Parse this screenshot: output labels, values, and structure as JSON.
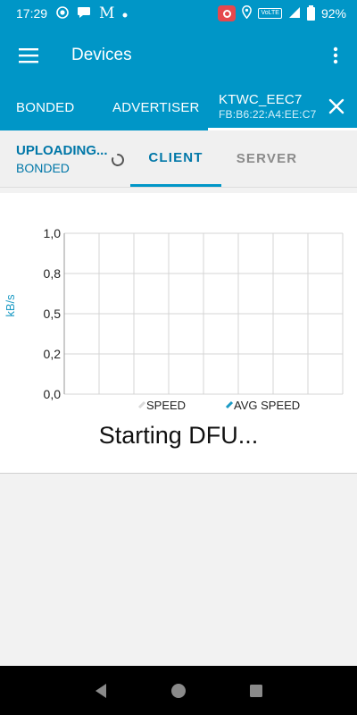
{
  "status_bar": {
    "time": "17:29",
    "battery": "92%",
    "volte": "VoLTE",
    "icons": [
      "screen-record-icon",
      "chat-icon",
      "gmail-icon",
      "dot-icon",
      "recording-badge-icon",
      "location-icon",
      "volte-icon",
      "signal-icon",
      "battery-icon"
    ]
  },
  "app_bar": {
    "title": "Devices"
  },
  "tabs": {
    "bonded": "BONDED",
    "advertiser": "ADVERTISER",
    "device_name": "KTWC_EEC7",
    "device_address": "FB:B6:22:A4:EE:C7"
  },
  "connection": {
    "state": "UPLOADING...",
    "bond_state": "BONDED"
  },
  "subtabs": {
    "client": "CLIENT",
    "server": "SERVER"
  },
  "chart_data": {
    "type": "line",
    "ylabel": "kB/s",
    "xlabel": "",
    "ylim": [
      0,
      1.0
    ],
    "y_ticks": [
      "0,0",
      "0,2",
      "0,5",
      "0,8",
      "1,0"
    ],
    "y_tick_values": [
      0,
      0.25,
      0.5,
      0.75,
      1.0
    ],
    "x_gridlines": 9,
    "grid": true,
    "legend_position": "bottom-center",
    "series": [
      {
        "name": "SPEED",
        "color": "#d9d9d9",
        "values": []
      },
      {
        "name": "AVG SPEED",
        "color": "#1b9ac4",
        "values": []
      }
    ]
  },
  "dfu_status": "Starting DFU...",
  "colors": {
    "primary": "#0096c7",
    "primary_dark": "#0077a8",
    "background": "#f2f2f2"
  }
}
